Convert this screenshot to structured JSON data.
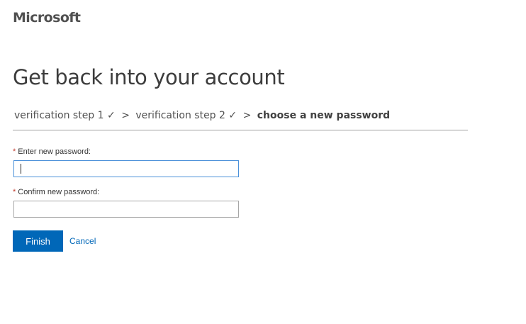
{
  "header": {
    "brand": "Microsoft"
  },
  "main": {
    "title": "Get back into your account",
    "steps": {
      "step1": "verification step 1 ✓",
      "step2": "verification step 2 ✓",
      "separator": ">",
      "current": "choose a new password"
    },
    "form": {
      "required_marker": "*",
      "new_password_label": "Enter new password:",
      "new_password_value": "",
      "confirm_password_label": "Confirm new password:",
      "confirm_password_value": ""
    },
    "actions": {
      "finish_label": "Finish",
      "cancel_label": "Cancel"
    }
  },
  "colors": {
    "accent": "#0067b8",
    "required": "#c0392b",
    "focus_border": "#4a90d9"
  }
}
